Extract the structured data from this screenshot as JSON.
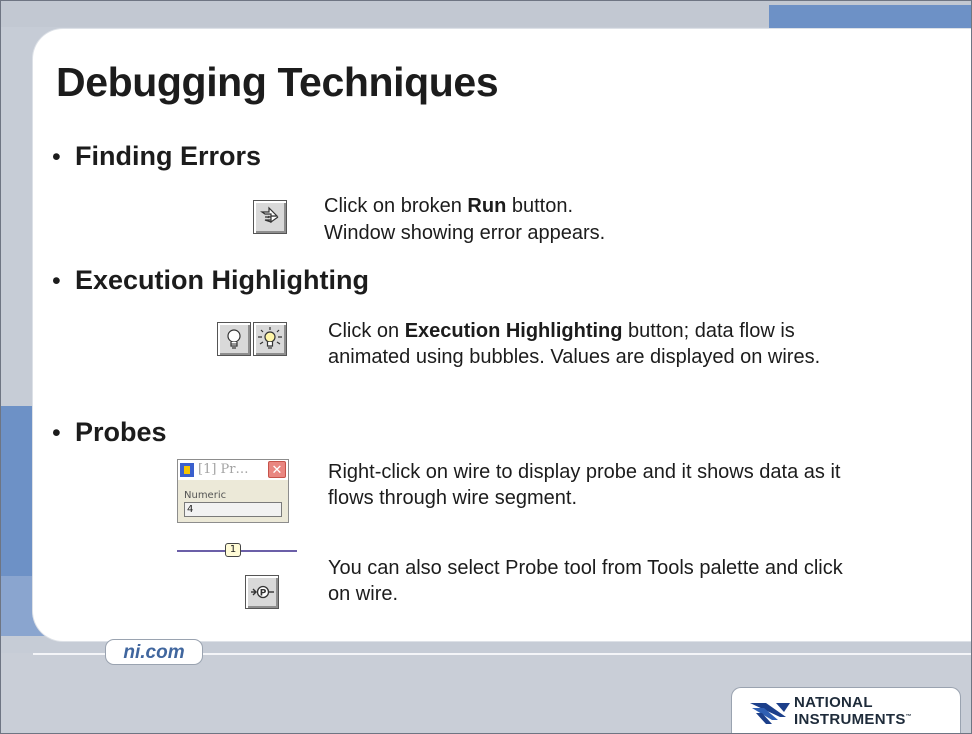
{
  "title": "Debugging Techniques",
  "bullet": "•",
  "sections": [
    {
      "heading": "Finding Errors",
      "lines": [
        {
          "pre": "Click on broken ",
          "bold": "Run",
          "post": " button."
        },
        {
          "text": "Window showing error appears."
        }
      ]
    },
    {
      "heading": "Execution Highlighting",
      "pre": "Click on ",
      "bold": "Execution Highlighting",
      "post": " button; data flow is animated using bubbles. Values are displayed on wires."
    },
    {
      "heading": "Probes",
      "text1": "Right-click on wire to display probe and it shows data as it flows through wire segment.",
      "text2": "You can also select Probe tool from Tools palette and click on wire."
    }
  ],
  "probe_window": {
    "title": "[1] Pr…",
    "close": "✕",
    "label": "Numeric",
    "value": "4"
  },
  "wire_probe_label": "1",
  "footer": {
    "link": "ni.com",
    "logo_line1": "NATIONAL",
    "logo_line2": "INSTRUMENTS",
    "logo_tm": "™"
  },
  "icons": {
    "broken_run": "broken-run-icon",
    "highlight_off": "lightbulb-off-icon",
    "highlight_on": "lightbulb-on-icon",
    "probe_tool": "probe-tool-icon",
    "vi": "vi-icon",
    "eagle": "ni-eagle-logo"
  },
  "colors": {
    "accent_blue": "#6d91c6",
    "link_blue": "#40669e",
    "wire": "#6b5fa8"
  }
}
